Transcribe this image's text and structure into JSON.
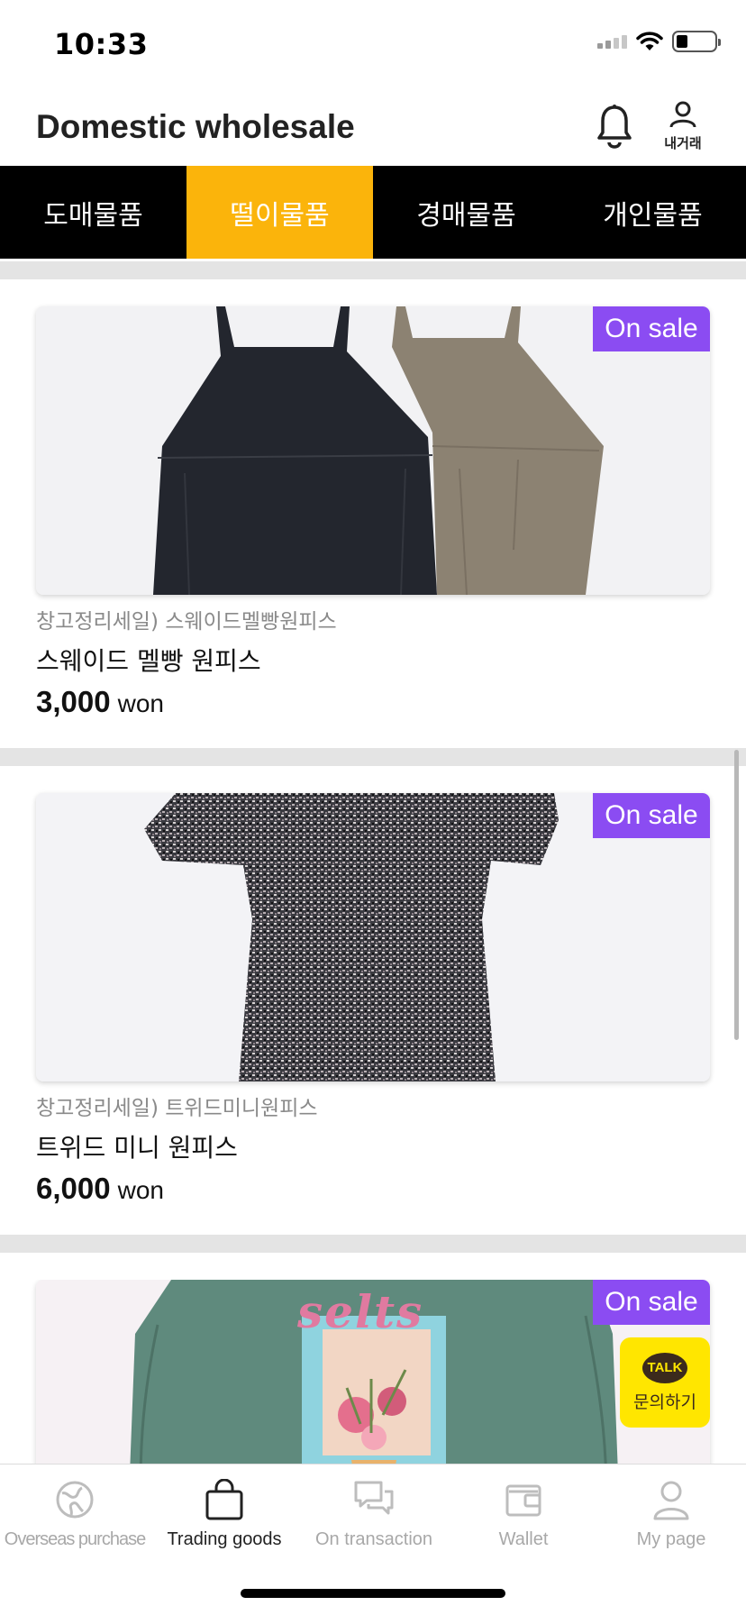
{
  "status": {
    "time": "10:33"
  },
  "header": {
    "title": "Domestic wholesale",
    "my_trade_label": "내거래"
  },
  "category_tabs": [
    {
      "label": "도매물품",
      "active": false
    },
    {
      "label": "떨이물품",
      "active": true
    },
    {
      "label": "경매물품",
      "active": false
    },
    {
      "label": "개인물품",
      "active": false
    }
  ],
  "products": [
    {
      "badge": "On sale",
      "subtitle": "창고정리세일) 스웨이드멜빵원피스",
      "title": "스웨이드 멜빵 원피스",
      "price": "3,000",
      "unit": "won"
    },
    {
      "badge": "On sale",
      "subtitle": "창고정리세일) 트위드미니원피스",
      "title": "트위드 미니 원피스",
      "price": "6,000",
      "unit": "won"
    },
    {
      "badge": "On sale",
      "image_text": "selts"
    }
  ],
  "kakao": {
    "bubble": "TALK",
    "label": "문의하기"
  },
  "bottom_nav": [
    {
      "label": "Overseas purchase",
      "icon": "globe-icon",
      "active": false
    },
    {
      "label": "Trading goods",
      "icon": "shopping-bag-icon",
      "active": true
    },
    {
      "label": "On transaction",
      "icon": "chat-bubbles-icon",
      "active": false
    },
    {
      "label": "Wallet",
      "icon": "wallet-icon",
      "active": false
    },
    {
      "label": "My page",
      "icon": "person-icon",
      "active": false
    }
  ],
  "colors": {
    "accent": "#fbb40b",
    "badge": "#8b4cf2",
    "kakao": "#ffe600",
    "tab_bar": "#000000"
  }
}
